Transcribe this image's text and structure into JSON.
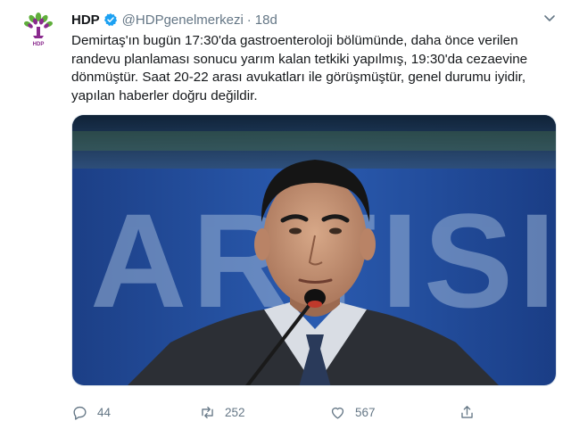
{
  "tweet": {
    "author_name": "HDP",
    "handle": "@HDPgenelmerkezi",
    "separator": "·",
    "time": "18d",
    "avatar_caption": "HDP",
    "text": "Demirtaş'ın bugün 17:30'da gastroenteroloji bölümünde, daha önce verilen\nrandevu planlaması sonucu yarım kalan tetkiki yapılmış, 19:30'da cezaevine\ndönmüştür. Saat 20-22 arası avukatları ile görüşmüştür, genel durumu iyidir,\nyapılan haberler doğru değildir.",
    "media_sign_text": "ARTISI"
  },
  "actions": {
    "replies": "44",
    "retweets": "252",
    "likes": "567"
  },
  "colors": {
    "verified": "#1da1f2",
    "muted": "#657786",
    "hdp_purple": "#8a2a8e",
    "hdp_green": "#5fae3b"
  },
  "icons": [
    "hdp-logo-icon",
    "verified-badge-icon",
    "chevron-down-icon",
    "reply-icon",
    "retweet-icon",
    "like-icon",
    "share-icon"
  ]
}
